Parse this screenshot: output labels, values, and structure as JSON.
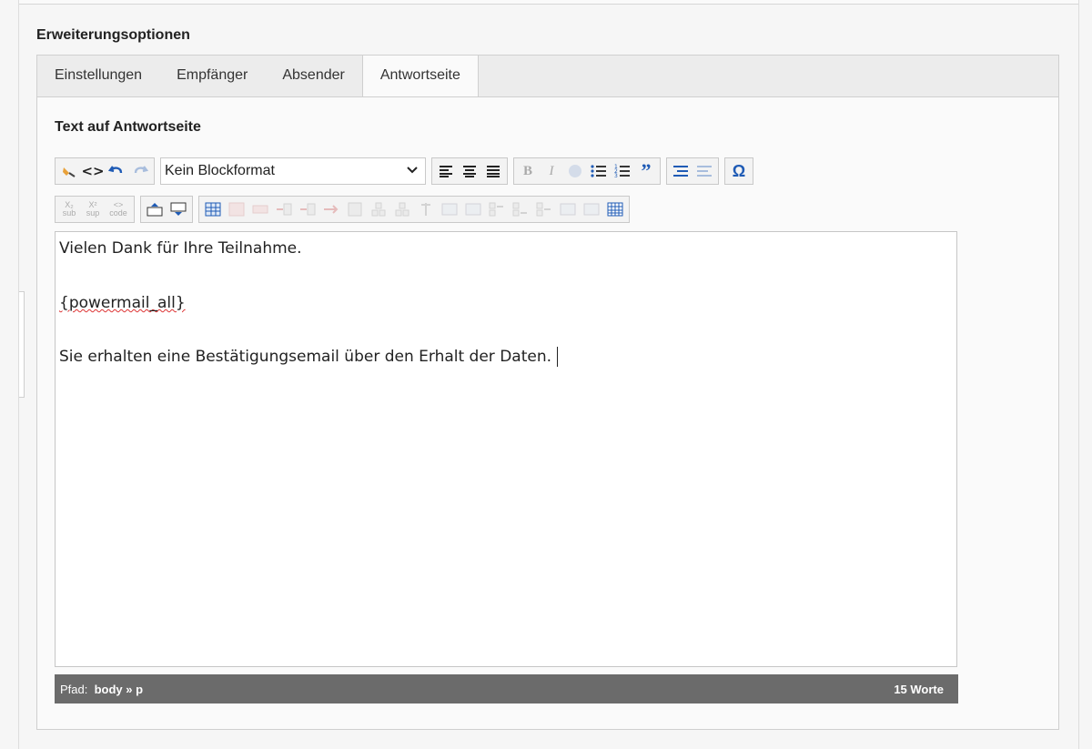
{
  "section": {
    "title": "Erweiterungsoptionen"
  },
  "tabs": [
    {
      "label": "Einstellungen"
    },
    {
      "label": "Empfänger"
    },
    {
      "label": "Absender"
    },
    {
      "label": "Antwortseite",
      "active": true
    }
  ],
  "field": {
    "label": "Text auf Antwortseite"
  },
  "toolbar": {
    "row1_icons": [
      "brush-icon",
      "source-code-icon",
      "undo-icon",
      "redo-icon"
    ],
    "blockformat": "Kein Blockformat",
    "align_icons": [
      "align-left-icon",
      "align-center-icon",
      "align-justify-icon"
    ],
    "format_icons": [
      "bold-icon",
      "italic-icon",
      "link-icon",
      "bullet-list-icon",
      "numbered-list-icon",
      "blockquote-icon"
    ],
    "indent_icons": [
      "indent-icon",
      "outdent-icon"
    ],
    "special_icons": [
      "omega-icon"
    ],
    "row2_sub": "sub",
    "row2_sup": "sup",
    "row2_code": "code"
  },
  "editor": {
    "line1": "Vielen Dank für Ihre Teilnahme.",
    "line2": "{powermail_all}",
    "line3": "Sie erhalten eine Bestätigungsemail über den Erhalt der Daten."
  },
  "status": {
    "path_label": "Pfad:",
    "path_value": "body » p",
    "word_count": "15 Worte"
  },
  "colors": {
    "accent": "#1f5bb5",
    "statusbar": "#6b6b6b"
  }
}
